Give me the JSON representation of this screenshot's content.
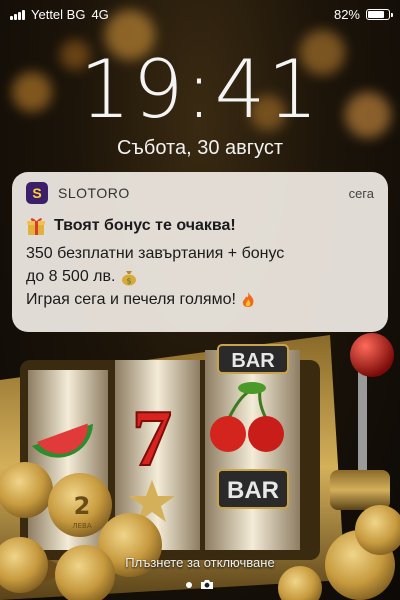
{
  "status": {
    "carrier": "Yettel BG",
    "network": "4G",
    "battery_text": "82%",
    "battery_level": 0.82
  },
  "lock": {
    "time": "19:41",
    "date": "Събота, 30 август"
  },
  "notification": {
    "app_icon_letter": "S",
    "app_name": "SLOTORO",
    "time": "сега",
    "title": "Твоят бонус те очаква!",
    "line1": "350 безплатни завъртания + бонус",
    "line2": "до 8 500 лв.",
    "line3": "Играя сега и печеля голямо!",
    "icons": [
      "gift-icon",
      "money-bag-icon",
      "fire-icon"
    ]
  },
  "scene": {
    "reel_symbols": [
      "BAR",
      "7",
      "BAR"
    ],
    "coin_label": "ЛЕВА",
    "coin_value": "2"
  },
  "hint": "Плъзнете за отключване",
  "colors": {
    "notification_bg": "#f0ebe4",
    "app_icon_bg": "#3b1f6b"
  }
}
